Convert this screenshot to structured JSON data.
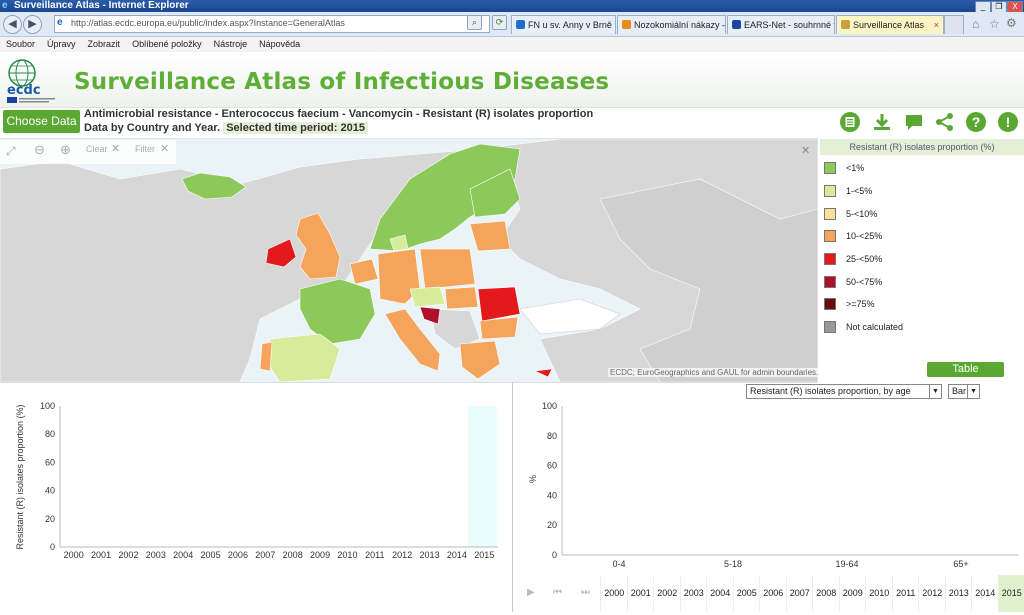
{
  "window": {
    "title": "Surveillance Atlas - Internet Explorer",
    "minimize": "_",
    "restore": "❐",
    "close": "X"
  },
  "browser": {
    "url": "http://atlas.ecdc.europa.eu/public/index.aspx?Instance=GeneralAtlas",
    "tabs": [
      {
        "label": "FN u sv. Anny v Brně ...",
        "color": "#1f6fd0",
        "active": false
      },
      {
        "label": "Nozokomiální nákazy –...",
        "color": "#e98a1c",
        "active": false
      },
      {
        "label": "EARS-Net - souhrnné v...",
        "color": "#1a47a0",
        "active": false
      },
      {
        "label": "Surveillance Atlas",
        "color": "#c7a23a",
        "active": true
      }
    ],
    "tab_close": "×"
  },
  "menu": [
    "Soubor",
    "Úpravy",
    "Zobrazit",
    "Oblíbené položky",
    "Nástroje",
    "Nápověda"
  ],
  "site": {
    "logo_text": "ecdc",
    "title": "Surveillance Atlas of Infectious Diseases"
  },
  "toolbar": {
    "choose_data": "Choose Data",
    "dataset_title": "Antimicrobial resistance - Enterococcus faecium - Vancomycin - Resistant (R) isolates proportion",
    "dataset_sub": "Data by Country and Year.",
    "selected_period": "Selected time period: 2015",
    "icons": [
      "book-icon",
      "download-icon",
      "comment-icon",
      "share-icon",
      "help-icon",
      "info-icon"
    ]
  },
  "map": {
    "tools": {
      "clear": "Clear",
      "filter": "Filter"
    },
    "credit": "ECDC; EuroGeographics and GAUL for admin boundaries."
  },
  "legend": {
    "title": "Resistant (R) isolates proportion (%)",
    "items": [
      {
        "label": "<1%",
        "color": "#8dc85a"
      },
      {
        "label": "1-<5%",
        "color": "#d6ec9a"
      },
      {
        "label": "5-<10%",
        "color": "#fbe19a"
      },
      {
        "label": "10-<25%",
        "color": "#f5a55b"
      },
      {
        "label": "25-<50%",
        "color": "#e31a1c"
      },
      {
        "label": "50-<75%",
        "color": "#b0102a"
      },
      {
        "label": ">=75%",
        "color": "#6b0a0a"
      },
      {
        "label": "Not calculated",
        "color": "#999999"
      }
    ],
    "table_button": "Table"
  },
  "left_chart": {
    "ylabel": "Resistant (R) isolates proportion (%)",
    "yticks": [
      "100",
      "80",
      "60",
      "40",
      "20",
      "0"
    ],
    "years": [
      "2000",
      "2001",
      "2002",
      "2003",
      "2004",
      "2005",
      "2006",
      "2007",
      "2008",
      "2009",
      "2010",
      "2011",
      "2012",
      "2013",
      "2014",
      "2015"
    ],
    "highlight_year": "2015"
  },
  "right_chart": {
    "dropdown": "Resistant (R) isolates proportion, by age",
    "type_dropdown": "Bar",
    "ylabel": "%",
    "yticks": [
      "100",
      "80",
      "60",
      "40",
      "20",
      "0"
    ],
    "age_groups": [
      "0-4",
      "5-18",
      "19-64",
      "65+"
    ],
    "year_strip": [
      "2000",
      "2001",
      "2002",
      "2003",
      "2004",
      "2005",
      "2006",
      "2007",
      "2008",
      "2009",
      "2010",
      "2011",
      "2012",
      "2013",
      "2014",
      "2015"
    ],
    "selected_year": "2015"
  },
  "chart_data": [
    {
      "type": "bar",
      "title": "",
      "xlabel": "",
      "ylabel": "Resistant (R) isolates proportion (%)",
      "categories": [
        "2000",
        "2001",
        "2002",
        "2003",
        "2004",
        "2005",
        "2006",
        "2007",
        "2008",
        "2009",
        "2010",
        "2011",
        "2012",
        "2013",
        "2014",
        "2015"
      ],
      "values": [],
      "ylim": [
        0,
        100
      ],
      "grid": false
    },
    {
      "type": "bar",
      "title": "",
      "xlabel": "",
      "ylabel": "%",
      "categories": [
        "0-4",
        "5-18",
        "19-64",
        "65+"
      ],
      "values": [],
      "ylim": [
        0,
        100
      ],
      "grid": false
    }
  ]
}
